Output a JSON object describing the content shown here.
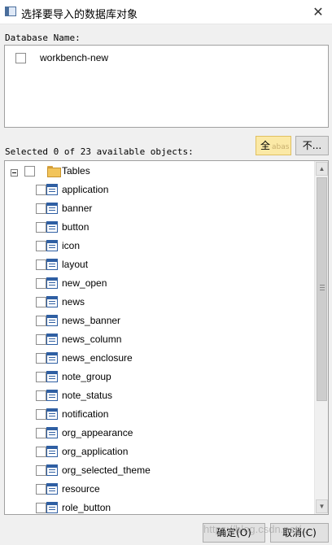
{
  "window": {
    "title": "选择要导入的数据库对象",
    "close_glyph": "✕"
  },
  "database": {
    "label": "Database Name:",
    "items": [
      {
        "label": "workbench-new",
        "checked": false
      }
    ]
  },
  "selection": {
    "summary": "Selected 0 of 23 available objects:",
    "select_all_label": "全",
    "select_all_ghost": "abas",
    "select_none_label": "不..."
  },
  "tree": {
    "root_label": "Tables",
    "items": [
      "application",
      "banner",
      "button",
      "icon",
      "layout",
      "new_open",
      "news",
      "news_banner",
      "news_column",
      "news_enclosure",
      "note_group",
      "note_status",
      "notification",
      "org_appearance",
      "org_application",
      "org_selected_theme",
      "resource",
      "role_button"
    ]
  },
  "footer": {
    "ok_label": "确定(O)",
    "cancel_label": "取消(C)"
  },
  "watermark": "https://blog.csdn.net/..."
}
